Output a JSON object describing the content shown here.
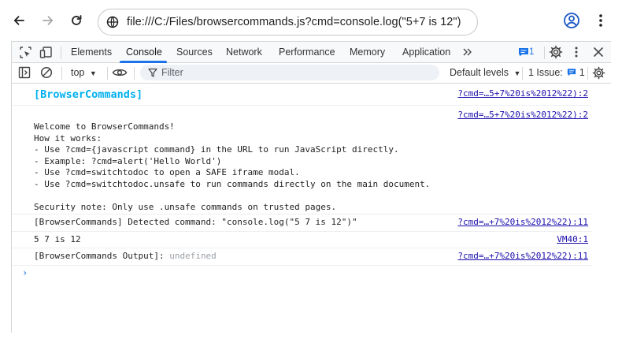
{
  "browser": {
    "url": "file:///C:/Files/browsercommands.js?cmd=console.log(\"5+7 is 12\")"
  },
  "devtools": {
    "tabs": [
      "Elements",
      "Console",
      "Sources",
      "Network",
      "Performance",
      "Memory",
      "Application"
    ],
    "active_tab": "Console",
    "issues_badge_count": "1",
    "console_bar": {
      "context": "top",
      "filter_placeholder": "Filter",
      "levels": "Default levels",
      "issues_label": "1 Issue:",
      "issues_count": "1"
    },
    "messages": [
      {
        "text": "[BrowserCommands]",
        "source": "?cmd=…5+7%20is%2012%22):2"
      },
      {
        "text": "Welcome to BrowserCommands!\nHow it works:\n- Use ?cmd={javascript command} in the URL to run JavaScript directly.\n- Example: ?cmd=alert('Hello World')\n- Use ?cmd=switchtodoc to open a SAFE iframe modal.\n- Use ?cmd=switchtodoc.unsafe to run commands directly on the main document.\n\nSecurity note: Only use .unsafe commands on trusted pages.",
        "source": "?cmd=…5+7%20is%2012%22):2"
      },
      {
        "text": "[BrowserCommands] Detected command: \"console.log(\"5 7 is 12\")\"",
        "source": "?cmd=…+7%20is%2012%22):11"
      },
      {
        "text": "5 7 is 12",
        "source": "VM40:1"
      },
      {
        "text": "[BrowserCommands Output]:",
        "value": "undefined",
        "source": "?cmd=…+7%20is%2012%22):11"
      }
    ],
    "prompt_symbol": "›"
  }
}
